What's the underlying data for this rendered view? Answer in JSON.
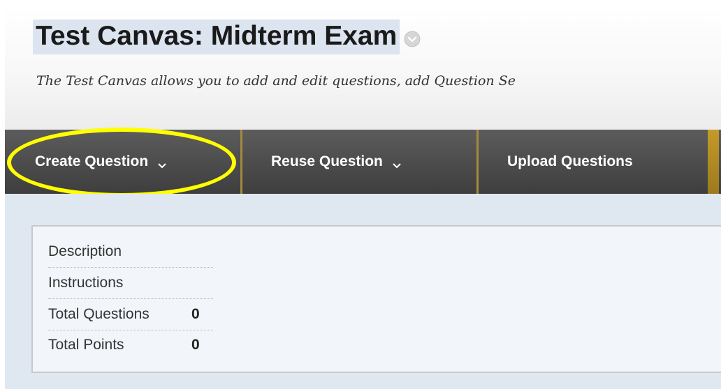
{
  "header": {
    "title": "Test Canvas: Midterm Exam",
    "subtitle": "The Test Canvas allows you to add and edit questions, add Question Se"
  },
  "actions": {
    "create_question": "Create Question",
    "reuse_question": "Reuse Question",
    "upload_questions": "Upload Questions"
  },
  "info": {
    "rows": [
      {
        "label": "Description",
        "value": ""
      },
      {
        "label": "Instructions",
        "value": ""
      },
      {
        "label": "Total Questions",
        "value": "0"
      },
      {
        "label": "Total Points",
        "value": "0"
      }
    ]
  },
  "colors": {
    "highlight": "#ffff00",
    "actionbar_separator": "#a38a3e",
    "title_highlight": "#dbe4ef",
    "content_bg": "#dfe7f0"
  },
  "icons": {
    "title_menu": "chevron-down-circle-icon",
    "create_dropdown": "chevron-down-icon",
    "reuse_dropdown": "chevron-down-icon"
  }
}
